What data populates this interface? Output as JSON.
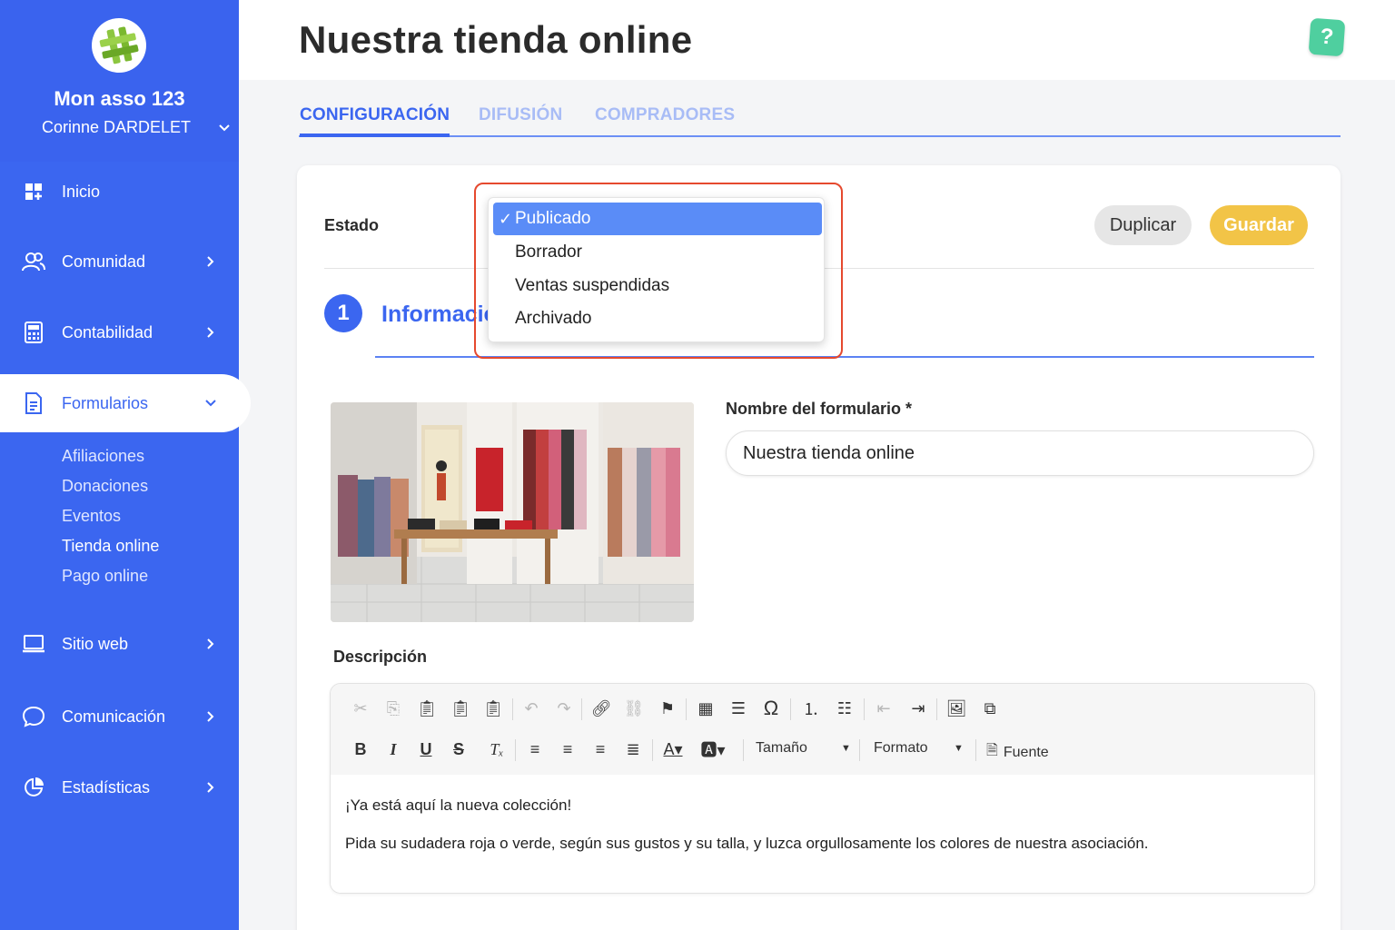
{
  "sidebar": {
    "org_name": "Mon asso 123",
    "user_name": "Corinne DARDELET",
    "nav": {
      "inicio": "Inicio",
      "comunidad": "Comunidad",
      "contabilidad": "Contabilidad",
      "formularios": "Formularios",
      "sitio_web": "Sitio web",
      "comunicacion": "Comunicación",
      "estadisticas": "Estadísticas"
    },
    "sub": {
      "afiliaciones": "Afiliaciones",
      "donaciones": "Donaciones",
      "eventos": "Eventos",
      "tienda": "Tienda online",
      "pago": "Pago online"
    },
    "accent_color": "#3b66f0"
  },
  "header": {
    "title": "Nuestra tienda online",
    "help": "?"
  },
  "tabs": {
    "config": "CONFIGURACIÓN",
    "difusion": "DIFUSIÓN",
    "compradores": "COMPRADORES"
  },
  "form": {
    "estado_label": "Estado",
    "dropdown": {
      "check": "✓",
      "options": [
        "Publicado",
        "Borrador",
        "Ventas suspendidas",
        "Archivado"
      ],
      "selected": "Publicado"
    },
    "duplicate_label": "Duplicar",
    "save_label": "Guardar",
    "step_number": "1",
    "section_title": "Informació",
    "name_label": "Nombre del formulario *",
    "name_value": "Nuestra tienda online",
    "description_label": "Descripción",
    "editor": {
      "size_label": "Tamaño",
      "format_label": "Formato",
      "source_label": "Fuente",
      "paragraph1": "¡Ya está aquí la nueva colección!",
      "paragraph2": "Pida su sudadera roja o verde, según sus gustos y su talla, y luzca orgullosamente los colores de nuestra asociación."
    }
  }
}
